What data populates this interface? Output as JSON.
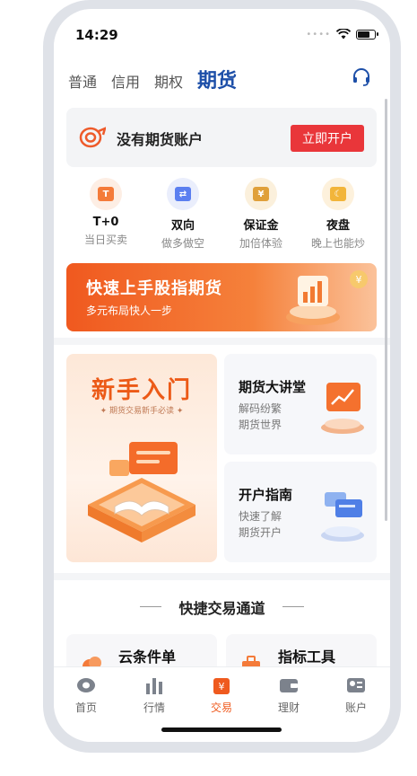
{
  "status_bar": {
    "time": "14:29"
  },
  "tabs": [
    {
      "label": "普通"
    },
    {
      "label": "信用"
    },
    {
      "label": "期权"
    },
    {
      "label": "期货",
      "active": true
    }
  ],
  "no_account": {
    "text": "没有期货账户",
    "button": "立即开户"
  },
  "features": [
    {
      "title": "T+0",
      "sub": "当日买卖",
      "icon": "calendar-icon",
      "color": "#f47b3a",
      "bg": "#fdeee4"
    },
    {
      "title": "双向",
      "sub": "做多做空",
      "icon": "exchange-icon",
      "color": "#5b7ff0",
      "bg": "#eaeefc"
    },
    {
      "title": "保证金",
      "sub": "加倍体验",
      "icon": "shield-yen-icon",
      "color": "#e0a03a",
      "bg": "#fbf0dc"
    },
    {
      "title": "夜盘",
      "sub": "晚上也能炒",
      "icon": "moon-monitor-icon",
      "color": "#f2b53a",
      "bg": "#fdf1dc"
    }
  ],
  "banner": {
    "title": "快速上手股指期货",
    "subtitle": "多元布局快人一步"
  },
  "newbie": {
    "title": "新手入门",
    "subtitle": "✦ 期货交易新手必读 ✦"
  },
  "side_cards": [
    {
      "title": "期货大讲堂",
      "line1": "解码纷繁",
      "line2": "期货世界"
    },
    {
      "title": "开户指南",
      "line1": "快速了解",
      "line2": "期货开户"
    }
  ],
  "quick": {
    "title": "快捷交易通道",
    "items": [
      {
        "label": "云条件单",
        "icon": "cloud-order-icon"
      },
      {
        "label": "指标工具",
        "icon": "toolbox-icon"
      }
    ]
  },
  "tabbar": [
    {
      "label": "首页",
      "icon": "home-icon"
    },
    {
      "label": "行情",
      "icon": "bar-chart-icon"
    },
    {
      "label": "交易",
      "icon": "trade-yen-icon",
      "active": true
    },
    {
      "label": "理财",
      "icon": "wallet-icon"
    },
    {
      "label": "账户",
      "icon": "account-card-icon"
    }
  ],
  "colors": {
    "brand_blue": "#1d4fa8",
    "accent_red": "#e9363a",
    "accent_orange": "#ef5a1e"
  }
}
